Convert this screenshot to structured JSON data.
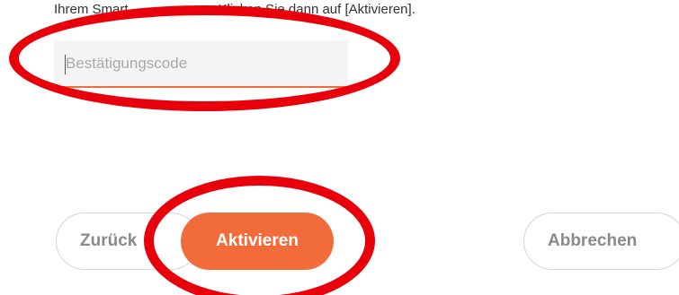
{
  "instruction": {
    "visible_start": "Ihrem Smart",
    "visible_mid": "Klicken Sie dann auf [Aktivieren]."
  },
  "code_input": {
    "placeholder": "Bestätigungscode",
    "value": ""
  },
  "buttons": {
    "back_label": "Zurück",
    "activate_label": "Aktivieren",
    "cancel_label": "Abbrechen"
  },
  "colors": {
    "accent": "#f26b3a",
    "annotation": "#e8000b",
    "input_bg": "#f4f4f4"
  }
}
